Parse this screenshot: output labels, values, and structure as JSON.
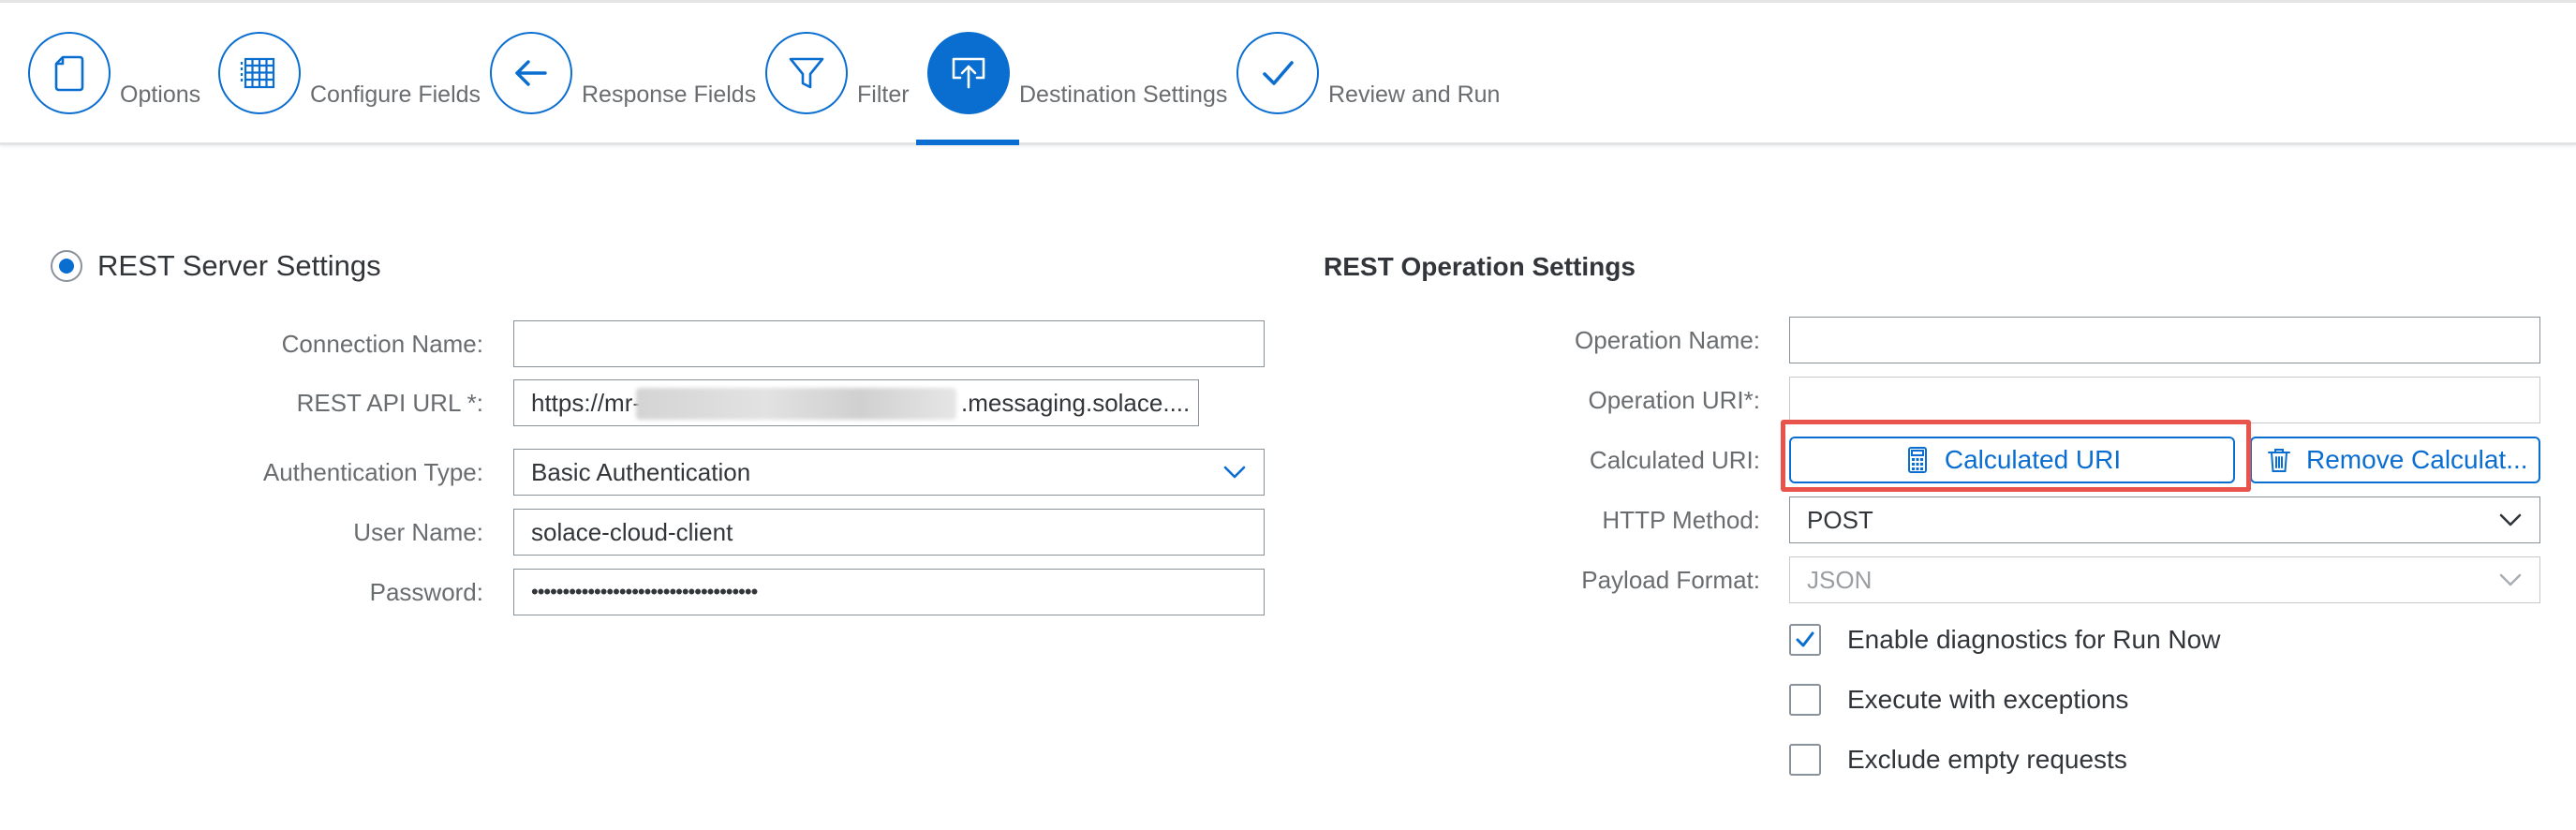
{
  "wizard": {
    "steps": [
      {
        "label": "Options",
        "icon": "document-icon"
      },
      {
        "label": "Configure Fields",
        "icon": "table-grid-icon"
      },
      {
        "label": "Response Fields",
        "icon": "arrow-left-icon"
      },
      {
        "label": "Filter",
        "icon": "filter-icon"
      },
      {
        "label": "Destination Settings",
        "icon": "upload-screen-icon",
        "active": true
      },
      {
        "label": "Review and Run",
        "icon": "checkmark-icon"
      }
    ]
  },
  "rest_server": {
    "title": "REST Server Settings",
    "selected": true,
    "fields": {
      "connection_name": {
        "label": "Connection Name:",
        "value": ""
      },
      "api_url": {
        "label": "REST API URL *:",
        "value_prefix": "https://mr-",
        "value_suffix": ".messaging.solace...."
      },
      "auth_type": {
        "label": "Authentication Type:",
        "value": "Basic Authentication"
      },
      "user_name": {
        "label": "User Name:",
        "value": "solace-cloud-client"
      },
      "password": {
        "label": "Password:",
        "value": "••••••••••••••••••••••••••••••••••••"
      }
    }
  },
  "rest_operation": {
    "title": "REST Operation Settings",
    "fields": {
      "operation_name": {
        "label": "Operation Name:",
        "value": ""
      },
      "operation_uri": {
        "label": "Operation URI*:",
        "value": ""
      },
      "calculated_uri": {
        "label": "Calculated URI:"
      },
      "http_method": {
        "label": "HTTP Method:",
        "value": "POST"
      },
      "payload_format": {
        "label": "Payload Format:",
        "value": "JSON"
      }
    },
    "buttons": {
      "calculated_uri": "Calculated URI",
      "remove_calculated": "Remove Calculat..."
    },
    "options": [
      {
        "label": "Enable diagnostics for Run Now",
        "checked": true
      },
      {
        "label": "Execute with exceptions",
        "checked": false
      },
      {
        "label": "Exclude empty requests",
        "checked": false
      }
    ]
  },
  "colors": {
    "accent": "#0a6ed1",
    "highlight_box": "#e8534b",
    "label_text": "#6a6d70"
  }
}
